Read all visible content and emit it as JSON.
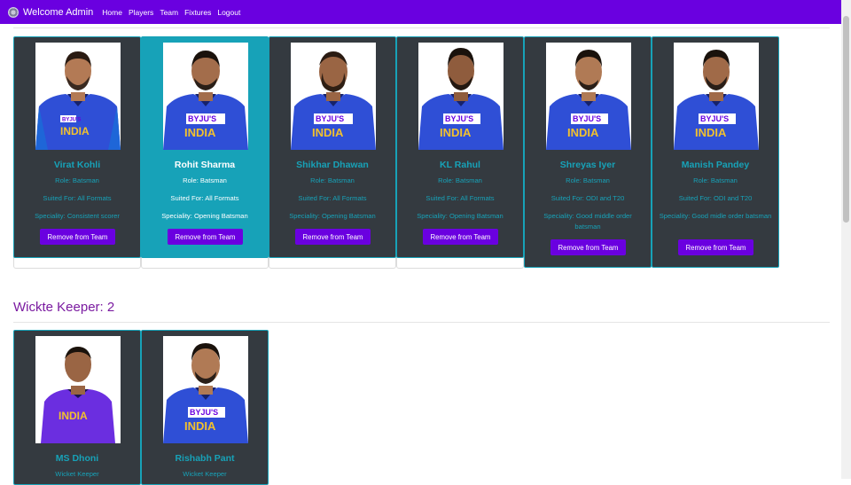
{
  "navbar": {
    "brand": "Welcome Admin",
    "links": [
      "Home",
      "Players",
      "Team",
      "Fixtures",
      "Logout"
    ]
  },
  "batsmen": [
    {
      "name": "Virat Kohli",
      "role": "Role: Batsman",
      "suited": "Suited For: All Formats",
      "speciality": "Speciality: Consistent scorer",
      "button": "Remove from Team"
    },
    {
      "name": "Rohit Sharma",
      "role": "Role: Batsman",
      "suited": "Suited For: All Formats",
      "speciality": "Speciality: Opening Batsman",
      "button": "Remove from Team"
    },
    {
      "name": "Shikhar Dhawan",
      "role": "Role: Batsman",
      "suited": "Suited For: All Formats",
      "speciality": "Speciality: Opening Batsman",
      "button": "Remove from Team"
    },
    {
      "name": "KL Rahul",
      "role": "Role: Batsman",
      "suited": "Suited For: All Formats",
      "speciality": "Speciality: Opening Batsman",
      "button": "Remove from Team"
    },
    {
      "name": "Shreyas Iyer",
      "role": "Role: Batsman",
      "suited": "Suited For: ODI and T20",
      "speciality": "Speciality: Good middle order batsman",
      "button": "Remove from Team"
    },
    {
      "name": "Manish Pandey",
      "role": "Role: Batsman",
      "suited": "Suited For: ODI and T20",
      "speciality": "Speciality: Good midle order batsman",
      "button": "Remove from Team"
    }
  ],
  "keeper_section": {
    "title": "Wickte Keeper: 2"
  },
  "keepers": [
    {
      "name": "MS Dhoni",
      "role": "Wicket Keeper"
    },
    {
      "name": "Rishabh Pant",
      "role": "Wicket Keeper"
    }
  ],
  "jersey": {
    "sponsor": "BYJU'S",
    "team": "INDIA"
  },
  "colors": {
    "nav": "#6a00e0",
    "card_dark": "#343a40",
    "accent": "#17a2b8",
    "button": "#6a00e0",
    "section_title": "#7a1aa0"
  }
}
